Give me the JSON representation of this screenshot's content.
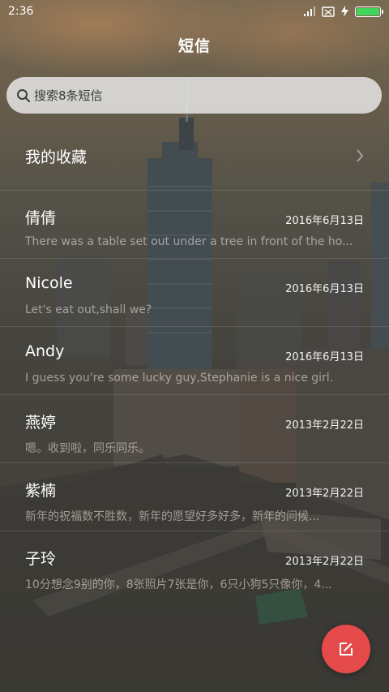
{
  "status_bar": {
    "time": "2:36"
  },
  "header": {
    "title": "短信"
  },
  "search": {
    "placeholder": "搜索8条短信"
  },
  "favorites": {
    "label": "我的收藏"
  },
  "conversations": [
    {
      "name": "倩倩",
      "date": "2016年6月13日",
      "preview": "There was a table set out under a tree in front of the ho..."
    },
    {
      "name": "Nicole",
      "date": "2016年6月13日",
      "preview": "Let's eat out,shall we?"
    },
    {
      "name": "Andy",
      "date": "2016年6月13日",
      "preview": "I guess you're some lucky guy,Stephanie is a nice girl."
    },
    {
      "name": "燕婷",
      "date": "2013年2月22日",
      "preview": "嗯。收到啦，同乐同乐。"
    },
    {
      "name": "紫楠",
      "date": "2013年2月22日",
      "preview": "新年的祝福数不胜数，新年的愿望好多好多，新年的问候..."
    },
    {
      "name": "子玲",
      "date": "2013年2月22日",
      "preview": "10分想念9别的你，8张照片7张是你，6只小狗5只像你，4..."
    }
  ],
  "icons": {
    "search": "search-icon",
    "chevron": "chevron-right-icon",
    "compose": "compose-icon",
    "battery": "battery-icon",
    "charging": "charging-icon",
    "no_sim": "no-sim-icon",
    "signal": "signal-icon"
  },
  "colors": {
    "fab": "#e54a4a",
    "battery": "#3fd65b"
  }
}
